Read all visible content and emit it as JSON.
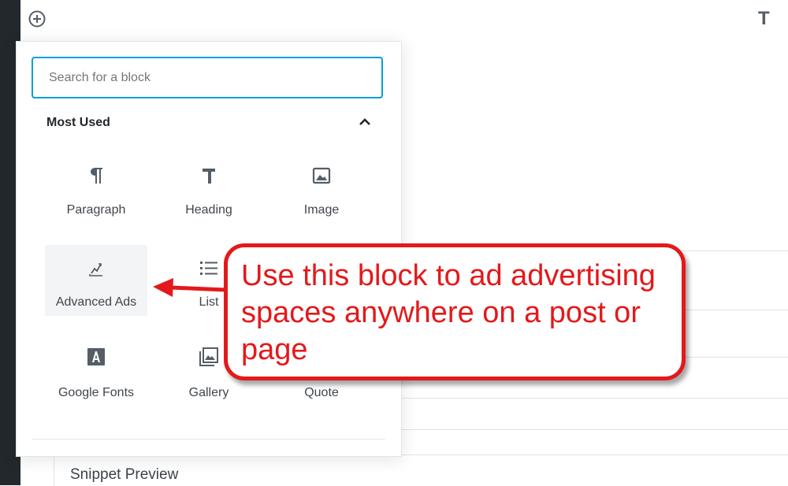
{
  "toolbar": {
    "right_icon_label": "T"
  },
  "inserter": {
    "search": {
      "placeholder": "Search for a block",
      "value": ""
    },
    "section": {
      "title": "Most Used"
    },
    "blocks": [
      {
        "label": "Paragraph",
        "icon": "paragraph-icon"
      },
      {
        "label": "Heading",
        "icon": "heading-icon"
      },
      {
        "label": "Image",
        "icon": "image-icon"
      },
      {
        "label": "Advanced Ads",
        "icon": "chart-line-icon"
      },
      {
        "label": "List",
        "icon": "list-icon"
      },
      {
        "label": "",
        "icon": ""
      },
      {
        "label": "Google Fonts",
        "icon": "letter-a-icon"
      },
      {
        "label": "Gallery",
        "icon": "gallery-icon"
      },
      {
        "label": "Quote",
        "icon": "quote-icon"
      }
    ]
  },
  "callout": {
    "text": "Use this block to ad advertising spaces anywhere on a post or page"
  },
  "editor": {
    "snippet_preview_label": "Snippet Preview"
  },
  "colors": {
    "accent": "#00a0d2",
    "callout_red": "#e3191b",
    "sidebar_dark": "#23282d"
  }
}
